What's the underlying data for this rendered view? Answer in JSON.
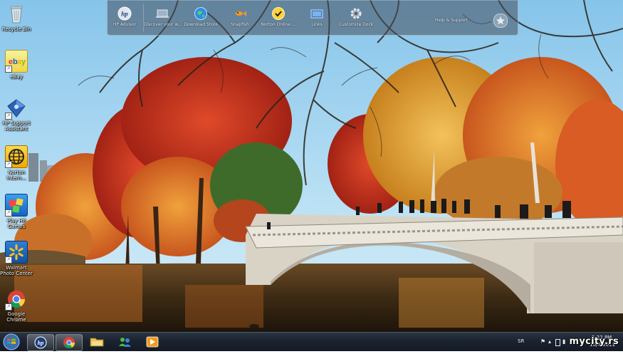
{
  "desktop_icons": [
    {
      "label": "Recycle Bin",
      "icon": "recycle-bin-icon"
    },
    {
      "label": "eBay",
      "icon": "ebay-icon"
    },
    {
      "label": "HP Support Assistant",
      "icon": "hp-support-icon"
    },
    {
      "label": "Norton Intern...",
      "icon": "norton-globe-icon"
    },
    {
      "label": "Play HP Games",
      "icon": "hp-games-icon"
    },
    {
      "label": "Walmart Photo Center",
      "icon": "walmart-spark-icon"
    },
    {
      "label": "Google Chrome",
      "icon": "chrome-icon"
    }
  ],
  "dock": {
    "items": [
      {
        "label": "HP Advisor",
        "icon": "hp-logo-icon"
      },
      {
        "label": "Discover your w...",
        "icon": "laptop-icon"
      },
      {
        "label": "Download Store",
        "icon": "globe-icon"
      },
      {
        "label": "Snapfish",
        "icon": "snapfish-icon"
      },
      {
        "label": "Norton Online ...",
        "icon": "norton-icon"
      },
      {
        "label": "Links",
        "icon": "links-icon"
      },
      {
        "label": "Customize Dock",
        "icon": "gear-icon"
      }
    ],
    "help_label": "Help & Support",
    "star_icon": "star-icon"
  },
  "taskbar": {
    "pinned": [
      {
        "name": "hp",
        "icon": "hp-logo-icon"
      },
      {
        "name": "chrome",
        "icon": "chrome-icon"
      },
      {
        "name": "explorer",
        "icon": "folder-icon"
      },
      {
        "name": "messenger",
        "icon": "people-icon"
      },
      {
        "name": "media",
        "icon": "media-player-icon"
      }
    ],
    "language": "SR",
    "time": "5:22 PM",
    "date": "10/4/2011"
  },
  "watermark": "mycity.rs",
  "colors": {
    "taskbar": "#1b2330",
    "dock": "#464e5c",
    "sky": "#9fd1ee"
  }
}
